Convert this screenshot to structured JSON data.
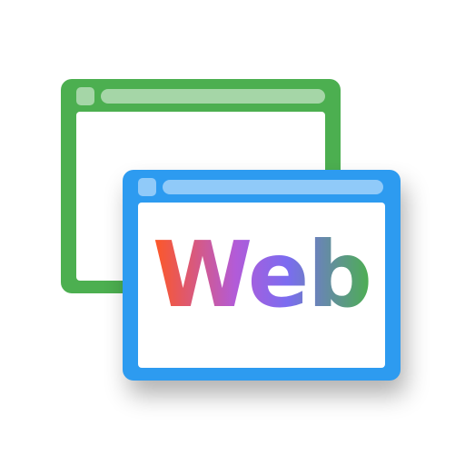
{
  "logo": {
    "text": "Web",
    "back_window_color": "#4caf50",
    "front_window_color": "#2d9bf0",
    "gradient_colors": [
      "#ff5722",
      "#b25bd8",
      "#7b6cf0",
      "#4caf50"
    ]
  }
}
